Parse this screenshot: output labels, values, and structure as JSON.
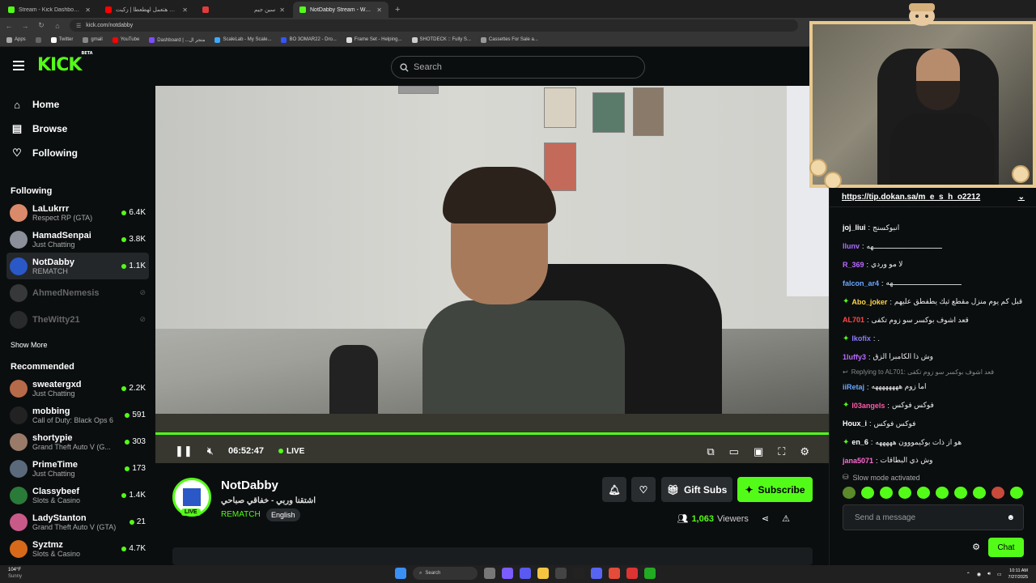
{
  "browser": {
    "tabs": [
      {
        "label": "Stream - Kick Dashboard",
        "color": "#53fc18"
      },
      {
        "label": "مهرجان هتعمل لهطعطا | زكيت",
        "color": "#ff0000"
      },
      {
        "label": "سين جيم",
        "color": "#e23b3b"
      },
      {
        "label": "NotDabby Stream - Watch Live",
        "color": "#53fc18",
        "active": true
      }
    ],
    "url": "kick.com/notdabby",
    "bookmarks": [
      "Apps",
      "Twitter",
      "gmail",
      "YouTube",
      "Dashboard | ...متجر ال",
      "ScaleLab - My Scale...",
      "BO 3OMAR22 - Dro...",
      "Frame Set - Helping...",
      "SHOTDECK :: Fully S...",
      "Cassettes For Sale a..."
    ]
  },
  "header": {
    "logo": "KICK",
    "logo_sup": "BETA",
    "search_placeholder": "Search"
  },
  "sidebar": {
    "nav": [
      {
        "label": "Home",
        "icon": "home-icon"
      },
      {
        "label": "Browse",
        "icon": "browse-icon"
      },
      {
        "label": "Following",
        "icon": "heart-icon"
      }
    ],
    "following_title": "Following",
    "following": [
      {
        "name": "LaLukrrr",
        "category": "Respect RP (GTA)",
        "viewers": "6.4K",
        "color": "#d98a6a"
      },
      {
        "name": "HamadSenpai",
        "category": "Just Chatting",
        "viewers": "3.8K",
        "color": "#8a8f99"
      },
      {
        "name": "NotDabby",
        "category": "REMATCH",
        "viewers": "1.1K",
        "color": "#2a58c7",
        "active": true
      },
      {
        "name": "AhmedNemesis",
        "offline": true,
        "color": "#777"
      },
      {
        "name": "TheWitty21",
        "offline": true,
        "color": "#555"
      }
    ],
    "show_more": "Show More",
    "recommended_title": "Recommended",
    "recommended": [
      {
        "name": "sweatergxd",
        "category": "Just Chatting",
        "viewers": "2.2K",
        "color": "#b56a4a"
      },
      {
        "name": "mobbing",
        "category": "Call of Duty: Black Ops 6",
        "viewers": "591",
        "color": "#222"
      },
      {
        "name": "shortypie",
        "category": "Grand Theft Auto V (G...",
        "viewers": "303",
        "color": "#9a7b6a"
      },
      {
        "name": "PrimeTime",
        "category": "Just Chatting",
        "viewers": "173",
        "color": "#5a6a7a"
      },
      {
        "name": "Classybeef",
        "category": "Slots & Casino",
        "viewers": "1.4K",
        "color": "#2a7a3a"
      },
      {
        "name": "LadyStanton",
        "category": "Grand Theft Auto V (GTA)",
        "viewers": "21",
        "color": "#c85a8a"
      },
      {
        "name": "Syztmz",
        "category": "Slots & Casino",
        "viewers": "4.7K",
        "color": "#d66a1a"
      }
    ]
  },
  "player": {
    "time": "06:52:47",
    "live_label": "LIVE"
  },
  "stream": {
    "name": "NotDabby",
    "title": "اشتقنا وربي - خفاقي صباحي",
    "category": "REMATCH",
    "language": "English",
    "live_tag": "LIVE",
    "gift_label": "Gift Subs",
    "subscribe_label": "Subscribe",
    "viewers": "1,063",
    "viewers_label": "Viewers"
  },
  "chat": {
    "pinned": "https://tip.dokan.sa/m_e_s_h_o2212",
    "messages": [
      {
        "user": "joj_liui",
        "text": "انبوكسنج",
        "color": "#ffffff"
      },
      {
        "user": "llunv",
        "text": "ــــــــــــــــــــــــــــــــهه",
        "color": "#a970ff"
      },
      {
        "user": "R_369",
        "text": "لا مو وردي",
        "color": "#b96bff"
      },
      {
        "user": "falcon_ar4",
        "text": "ــــــــــــــــــــــــــــــــهه",
        "color": "#6aa7ff"
      },
      {
        "user": "Abo_joker",
        "text": "قبل كم يوم منزل مقطع ثيك يطفطق عليهم",
        "color": "#ffd54a",
        "badge": true
      },
      {
        "user": "AL701",
        "text": "قعد اشوف بوكسر سو زوم تكفى",
        "color": "#ff4a4a"
      },
      {
        "user": "Ikofix",
        "text": ".",
        "color": "#8a7bff",
        "badge": true
      },
      {
        "user": "1luffy3",
        "text": "وش ذا الكامبرا الزق",
        "color": "#b96bff"
      }
    ],
    "reply_label": "Replying to AL701: قعد اشوف بوكسر سو زوم تكفى",
    "messages2": [
      {
        "user": "iiRetaj",
        "text": "اما زوم ههههههههه",
        "color": "#6aa7ff"
      },
      {
        "user": "l03angels",
        "text": "فوكس فوكس",
        "color": "#ff5aa7",
        "badge": true
      },
      {
        "user": "Houx_i",
        "text": "فوكس فوكس",
        "color": "#ffffff"
      },
      {
        "user": "en_6",
        "text": "هو از ذات بوكيمووون هههههه",
        "color": "#ffffff",
        "badge": true
      },
      {
        "user": "jana5071",
        "text": "وش ذي البطاقات",
        "color": "#ff6ad5"
      }
    ],
    "slow_mode": "Slow mode activated",
    "send_placeholder": "Send a message",
    "chat_button": "Chat"
  },
  "taskbar": {
    "weather_temp": "104°F",
    "weather_desc": "Sunny",
    "search": "Search",
    "time": "10:11 AM",
    "date": "7/27/2025"
  },
  "colors": {
    "accent": "#53fc18",
    "bg": "#0b0e0f"
  }
}
